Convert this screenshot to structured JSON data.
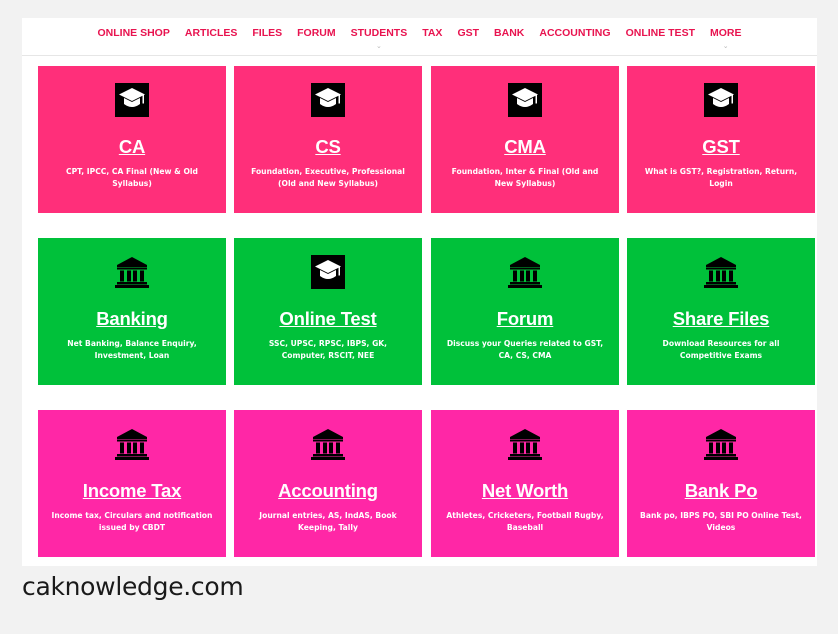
{
  "colors": {
    "pink_red": "#ff2f7a",
    "green": "#00c13a",
    "magenta": "#ff27a6",
    "nav_text": "#e8134f"
  },
  "nav": {
    "items": [
      {
        "label": "ONLINE SHOP",
        "has_dropdown": false
      },
      {
        "label": "ARTICLES",
        "has_dropdown": false
      },
      {
        "label": "FILES",
        "has_dropdown": false
      },
      {
        "label": "FORUM",
        "has_dropdown": false
      },
      {
        "label": "STUDENTS",
        "has_dropdown": true
      },
      {
        "label": "TAX",
        "has_dropdown": false
      },
      {
        "label": "GST",
        "has_dropdown": false
      },
      {
        "label": "BANK",
        "has_dropdown": false
      },
      {
        "label": "ACCOUNTING",
        "has_dropdown": false
      },
      {
        "label": "ONLINE TEST",
        "has_dropdown": false
      },
      {
        "label": "MORE",
        "has_dropdown": true
      }
    ],
    "chevron_glyph": "⌄"
  },
  "tiles": [
    {
      "title": "CA",
      "desc": "CPT, IPCC, CA Final (New & Old Syllabus)",
      "icon": "graduation-cap-icon",
      "color": "pink_red"
    },
    {
      "title": "CS",
      "desc": "Foundation, Executive, Professional (Old and New Syllabus)",
      "icon": "graduation-cap-icon",
      "color": "pink_red"
    },
    {
      "title": "CMA",
      "desc": "Foundation, Inter & Final (Old and New Syllabus)",
      "icon": "graduation-cap-icon",
      "color": "pink_red"
    },
    {
      "title": "GST",
      "desc": "What is GST?, Registration, Return, Login",
      "icon": "graduation-cap-icon",
      "color": "pink_red"
    },
    {
      "title": "Banking",
      "desc": "Net Banking, Balance Enquiry, Investment, Loan",
      "icon": "bank-icon",
      "color": "green"
    },
    {
      "title": "Online Test",
      "desc": "SSC, UPSC, RPSC, IBPS, GK, Computer, RSCIT, NEE",
      "icon": "graduation-cap-icon",
      "color": "green"
    },
    {
      "title": "Forum",
      "desc": "Discuss your Queries related to GST, CA, CS, CMA",
      "icon": "bank-icon",
      "color": "green"
    },
    {
      "title": "Share Files",
      "desc": "Download Resources for all Competitive Exams",
      "icon": "bank-icon",
      "color": "green"
    },
    {
      "title": "Income Tax",
      "desc": "Income tax, Circulars and notification issued by CBDT",
      "icon": "bank-icon",
      "color": "magenta"
    },
    {
      "title": "Accounting",
      "desc": "Journal entries, AS, IndAS, Book Keeping, Tally",
      "icon": "bank-icon",
      "color": "magenta"
    },
    {
      "title": "Net Worth",
      "desc": "Athletes, Cricketers, Football Rugby, Baseball",
      "icon": "bank-icon",
      "color": "magenta"
    },
    {
      "title": "Bank Po",
      "desc": "Bank po, IBPS PO, SBI PO Online Test, Videos",
      "icon": "bank-icon",
      "color": "magenta"
    }
  ],
  "caption": "caknowledge.com"
}
